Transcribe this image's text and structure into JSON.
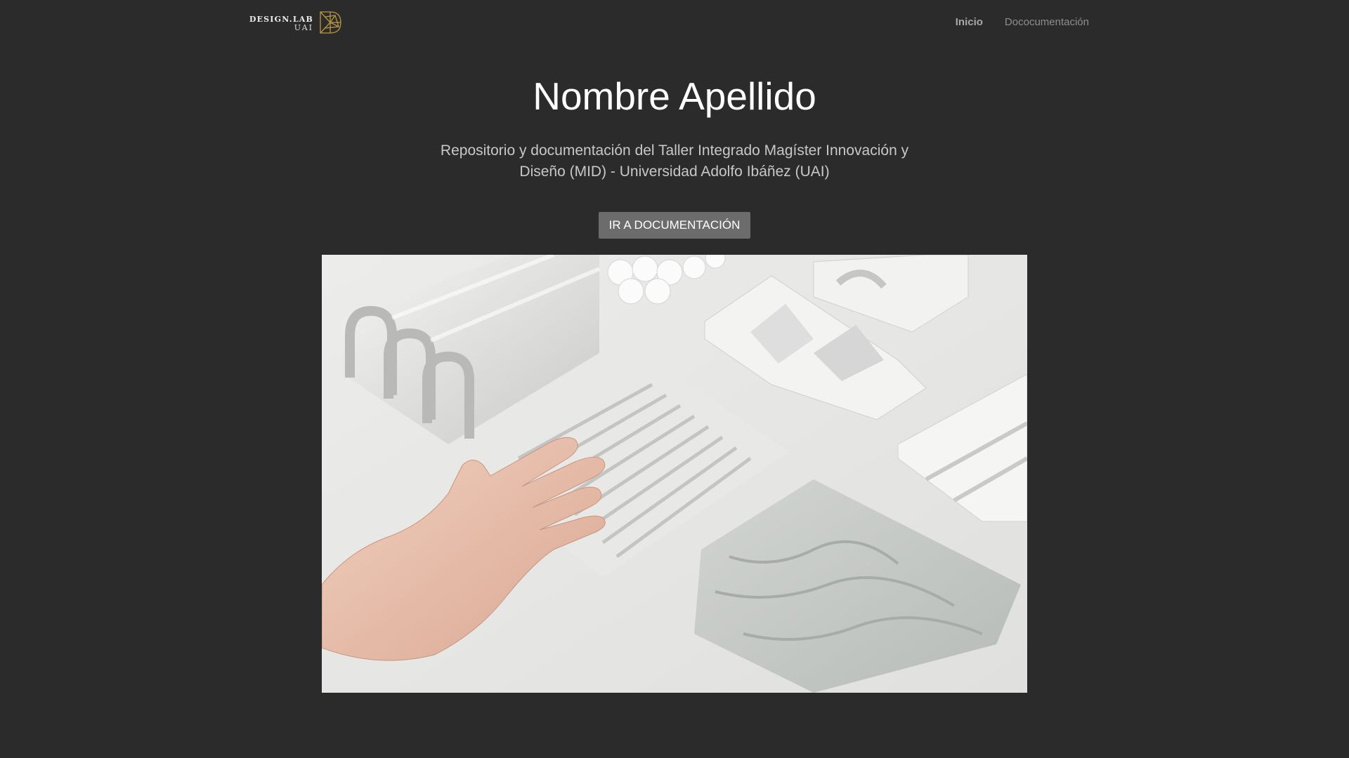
{
  "brand": {
    "logo_line1": "DESIGN.LAB",
    "logo_line2": "UAI",
    "logo_icon": "geometric-d-icon",
    "accent": "#b8973f"
  },
  "nav": {
    "items": [
      {
        "label": "Inicio",
        "active": true
      },
      {
        "label": "Dococumentación",
        "active": false
      }
    ]
  },
  "hero": {
    "title": "Nombre Apellido",
    "subtitle": "Repositorio y documentación del Taller Integrado Magíster Innovación y Diseño (MID) - Universidad Adolfo Ibáñez (UAI)",
    "cta_label": "IR A DOCUMENTACIÓN",
    "image_alt": "Manos sobre piezas blancas de materiales y texturas"
  },
  "colors": {
    "background": "#2b2b2b",
    "button": "#6c6c6c",
    "nav_text": "#8e8e8e"
  }
}
